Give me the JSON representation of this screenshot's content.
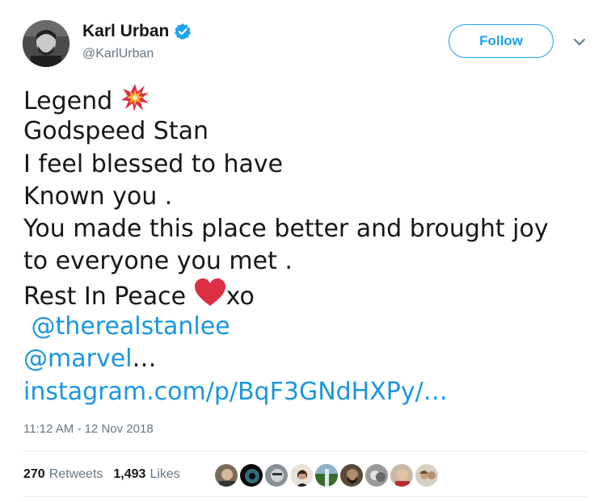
{
  "tweet": {
    "author": {
      "name": "Karl Urban",
      "handle": "@KarlUrban",
      "verified": true
    },
    "follow_label": "Follow",
    "lines": [
      {
        "text": "Legend ",
        "emoji": "collision-emoji"
      },
      {
        "text": "Godspeed Stan"
      },
      {
        "text": "I feel blessed to have"
      },
      {
        "text": "Known you ."
      },
      {
        "text": "You made this place better and brought joy"
      },
      {
        "text": "to everyone you met ."
      },
      {
        "text": "Rest In Peace ",
        "emoji": "heart-emoji",
        "after": "xo"
      }
    ],
    "mentions": [
      "@therealstanlee",
      "@marvel"
    ],
    "mention_suffix": "…",
    "link": "instagram.com/p/BqF3GNdHXPy/…",
    "timestamp": "11:12 AM - 12 Nov 2018",
    "stats": {
      "retweets_count": "270",
      "retweets_label": "Retweets",
      "likes_count": "1,493",
      "likes_label": "Likes"
    },
    "colors": {
      "accent": "#1da1f2",
      "link": "#1b95e0",
      "muted": "#657786",
      "text": "#14171a"
    }
  }
}
